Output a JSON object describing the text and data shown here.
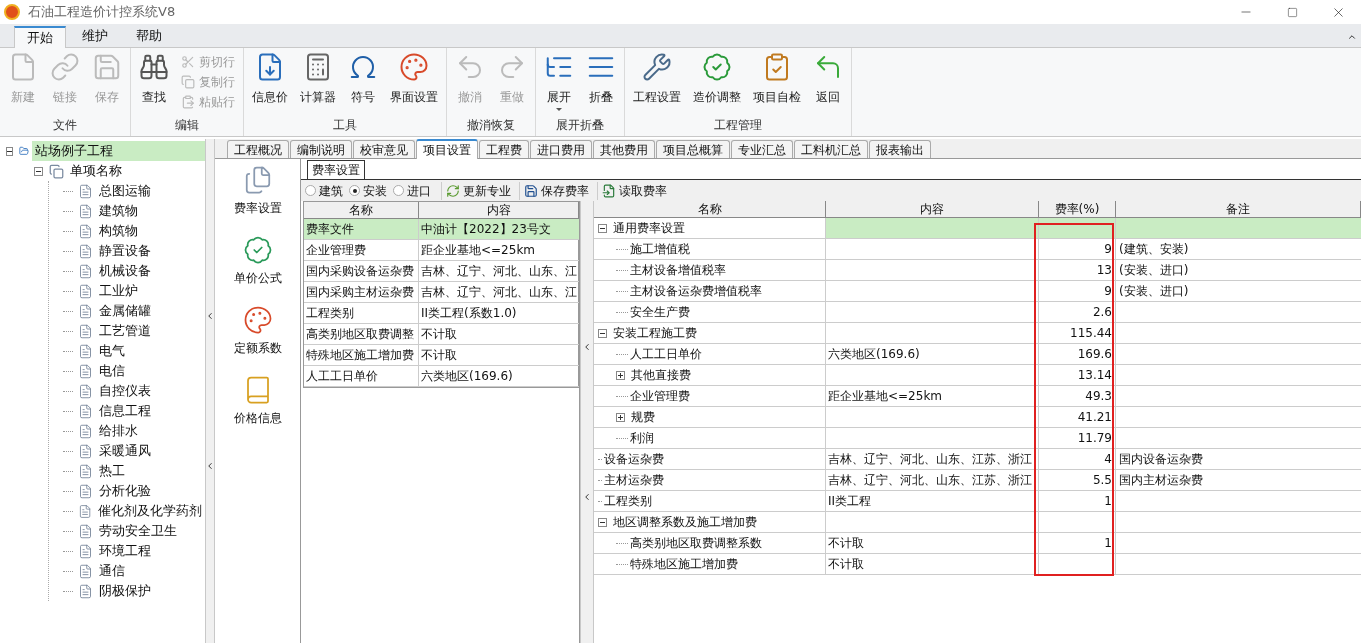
{
  "window": {
    "title": "石油工程造价计控系统V8"
  },
  "ribbon_tabs": [
    {
      "label": "开始",
      "selected": true
    },
    {
      "label": "维护",
      "selected": false
    },
    {
      "label": "帮助",
      "selected": false
    }
  ],
  "ribbon_groups": [
    {
      "label": "文件",
      "buttons": [
        {
          "label": "新建",
          "kind": "large",
          "disabled": true
        },
        {
          "label": "链接",
          "kind": "large",
          "disabled": true
        },
        {
          "label": "保存",
          "kind": "large",
          "disabled": true
        }
      ]
    },
    {
      "label": "编辑",
      "buttons": [
        {
          "label": "查找",
          "kind": "large",
          "disabled": false
        },
        {
          "label": "剪切行",
          "kind": "small",
          "disabled": true
        },
        {
          "label": "复制行",
          "kind": "small",
          "disabled": true
        },
        {
          "label": "粘贴行",
          "kind": "small",
          "disabled": true
        }
      ]
    },
    {
      "label": "工具",
      "buttons": [
        {
          "label": "信息价",
          "kind": "large",
          "disabled": false
        },
        {
          "label": "计算器",
          "kind": "large",
          "disabled": false
        },
        {
          "label": "符号",
          "kind": "large",
          "disabled": false
        },
        {
          "label": "界面设置",
          "kind": "large",
          "disabled": false
        }
      ]
    },
    {
      "label": "撤消恢复",
      "buttons": [
        {
          "label": "撤消",
          "kind": "large",
          "disabled": true
        },
        {
          "label": "重做",
          "kind": "large",
          "disabled": true
        }
      ]
    },
    {
      "label": "展开折叠",
      "buttons": [
        {
          "label": "展开",
          "kind": "dropdown",
          "disabled": false
        },
        {
          "label": "折叠",
          "kind": "large",
          "disabled": false
        }
      ]
    },
    {
      "label": "工程管理",
      "buttons": [
        {
          "label": "工程设置",
          "kind": "large",
          "disabled": false
        },
        {
          "label": "造价调整",
          "kind": "large",
          "disabled": false
        },
        {
          "label": "项目自检",
          "kind": "large",
          "disabled": false
        },
        {
          "label": "返回",
          "kind": "large",
          "disabled": false
        }
      ]
    }
  ],
  "project_tree": [
    {
      "label": "站场例子工程",
      "selected": true,
      "expanded": true,
      "children": [
        {
          "label": "单项名称",
          "selected": false,
          "expanded": true,
          "children": [
            {
              "label": "总图运输",
              "selected": false
            },
            {
              "label": "建筑物",
              "selected": false
            },
            {
              "label": "构筑物",
              "selected": false
            },
            {
              "label": "静置设备",
              "selected": false
            },
            {
              "label": "机械设备",
              "selected": false
            },
            {
              "label": "工业炉",
              "selected": false
            },
            {
              "label": "金属储罐",
              "selected": false
            },
            {
              "label": "工艺管道",
              "selected": false
            },
            {
              "label": "电气",
              "selected": false
            },
            {
              "label": "电信",
              "selected": false
            },
            {
              "label": "自控仪表",
              "selected": false
            },
            {
              "label": "信息工程",
              "selected": false
            },
            {
              "label": "给排水",
              "selected": false
            },
            {
              "label": "采暖通风",
              "selected": false
            },
            {
              "label": "热工",
              "selected": false
            },
            {
              "label": "分析化验",
              "selected": false
            },
            {
              "label": "催化剂及化学药剂",
              "selected": false
            },
            {
              "label": "劳动安全卫生",
              "selected": false
            },
            {
              "label": "环境工程",
              "selected": false
            },
            {
              "label": "通信",
              "selected": false
            },
            {
              "label": "阴极保护",
              "selected": false
            }
          ]
        }
      ]
    }
  ],
  "content_tabs": [
    {
      "label": "工程概况",
      "selected": false
    },
    {
      "label": "编制说明",
      "selected": false
    },
    {
      "label": "校审意见",
      "selected": false
    },
    {
      "label": "项目设置",
      "selected": true
    },
    {
      "label": "工程费",
      "selected": false
    },
    {
      "label": "进口费用",
      "selected": false
    },
    {
      "label": "其他费用",
      "selected": false
    },
    {
      "label": "项目总概算",
      "selected": false
    },
    {
      "label": "专业汇总",
      "selected": false
    },
    {
      "label": "工料机汇总",
      "selected": false
    },
    {
      "label": "报表输出",
      "selected": false
    }
  ],
  "side_nav": [
    {
      "label": "费率设置"
    },
    {
      "label": "单价公式"
    },
    {
      "label": "定额系数"
    },
    {
      "label": "价格信息"
    }
  ],
  "sub_tabs": [
    {
      "label": "费率设置",
      "selected": true
    }
  ],
  "category_options": [
    {
      "label": "建筑",
      "selected": false
    },
    {
      "label": "安装",
      "selected": true
    },
    {
      "label": "进口",
      "selected": false
    }
  ],
  "toolbar": [
    {
      "label": "更新专业"
    },
    {
      "label": "保存费率"
    },
    {
      "label": "读取费率"
    }
  ],
  "settings_table": {
    "columns": [
      "名称",
      "内容"
    ],
    "rows": [
      {
        "name": "费率文件",
        "content": "中油计【2022】23号文",
        "selected": true
      },
      {
        "name": "企业管理费",
        "content": "距企业基地<=25km",
        "selected": false
      },
      {
        "name": "国内采购设备运杂费",
        "content": "吉林、辽宁、河北、山东、江",
        "selected": false
      },
      {
        "name": "国内采购主材运杂费",
        "content": "吉林、辽宁、河北、山东、江",
        "selected": false
      },
      {
        "name": "工程类别",
        "content": "II类工程(系数1.0)",
        "selected": false
      },
      {
        "name": "高类别地区取费调整",
        "content": "不计取",
        "selected": false
      },
      {
        "name": "特殊地区施工增加费",
        "content": "不计取",
        "selected": false
      },
      {
        "name": "人工工日单价",
        "content": "六类地区(169.6)",
        "selected": false
      }
    ]
  },
  "rate_table": {
    "columns": [
      "名称",
      "内容",
      "费率(%)",
      "备注"
    ],
    "rows": [
      {
        "name": "通用费率设置",
        "selected": true,
        "expanded": true,
        "children": [
          {
            "name": "施工增值税",
            "rate": "9",
            "note": "(建筑、安装)",
            "selected": false
          },
          {
            "name": "主材设备增值税率",
            "rate": "13",
            "note": "(安装、进口)",
            "selected": false
          },
          {
            "name": "主材设备运杂费增值税率",
            "rate": "9",
            "note": "(安装、进口)",
            "selected": false
          },
          {
            "name": "安全生产费",
            "rate": "2.6",
            "selected": false
          }
        ]
      },
      {
        "name": "安装工程施工费",
        "rate": "115.44",
        "selected": false,
        "expanded": true,
        "children": [
          {
            "name": "人工工日单价",
            "content": "六类地区(169.6)",
            "rate": "169.6",
            "selected": false
          },
          {
            "name": "其他直接费",
            "rate": "13.14",
            "selected": false,
            "expanded": false
          },
          {
            "name": "企业管理费",
            "content": "距企业基地<=25km",
            "rate": "49.3",
            "selected": false
          },
          {
            "name": "规费",
            "rate": "41.21",
            "selected": false,
            "expanded": false
          },
          {
            "name": "利润",
            "rate": "11.79",
            "selected": false
          }
        ]
      },
      {
        "name": "设备运杂费",
        "content": "吉林、辽宁、河北、山东、江苏、浙江",
        "rate": "4",
        "note": "国内设备运杂费",
        "selected": false
      },
      {
        "name": "主材运杂费",
        "content": "吉林、辽宁、河北、山东、江苏、浙江",
        "rate": "5.5",
        "note": "国内主材运杂费",
        "selected": false
      },
      {
        "name": "工程类别",
        "content": "II类工程",
        "rate": "1",
        "selected": false
      },
      {
        "name": "地区调整系数及施工增加费",
        "selected": false,
        "expanded": true,
        "children": [
          {
            "name": "高类别地区取费调整系数",
            "content": "不计取",
            "rate": "1",
            "selected": false
          },
          {
            "name": "特殊地区施工增加费",
            "content": "不计取",
            "selected": false
          }
        ]
      }
    ]
  },
  "annotations": [
    {
      "kind": "rectangle"
    }
  ]
}
